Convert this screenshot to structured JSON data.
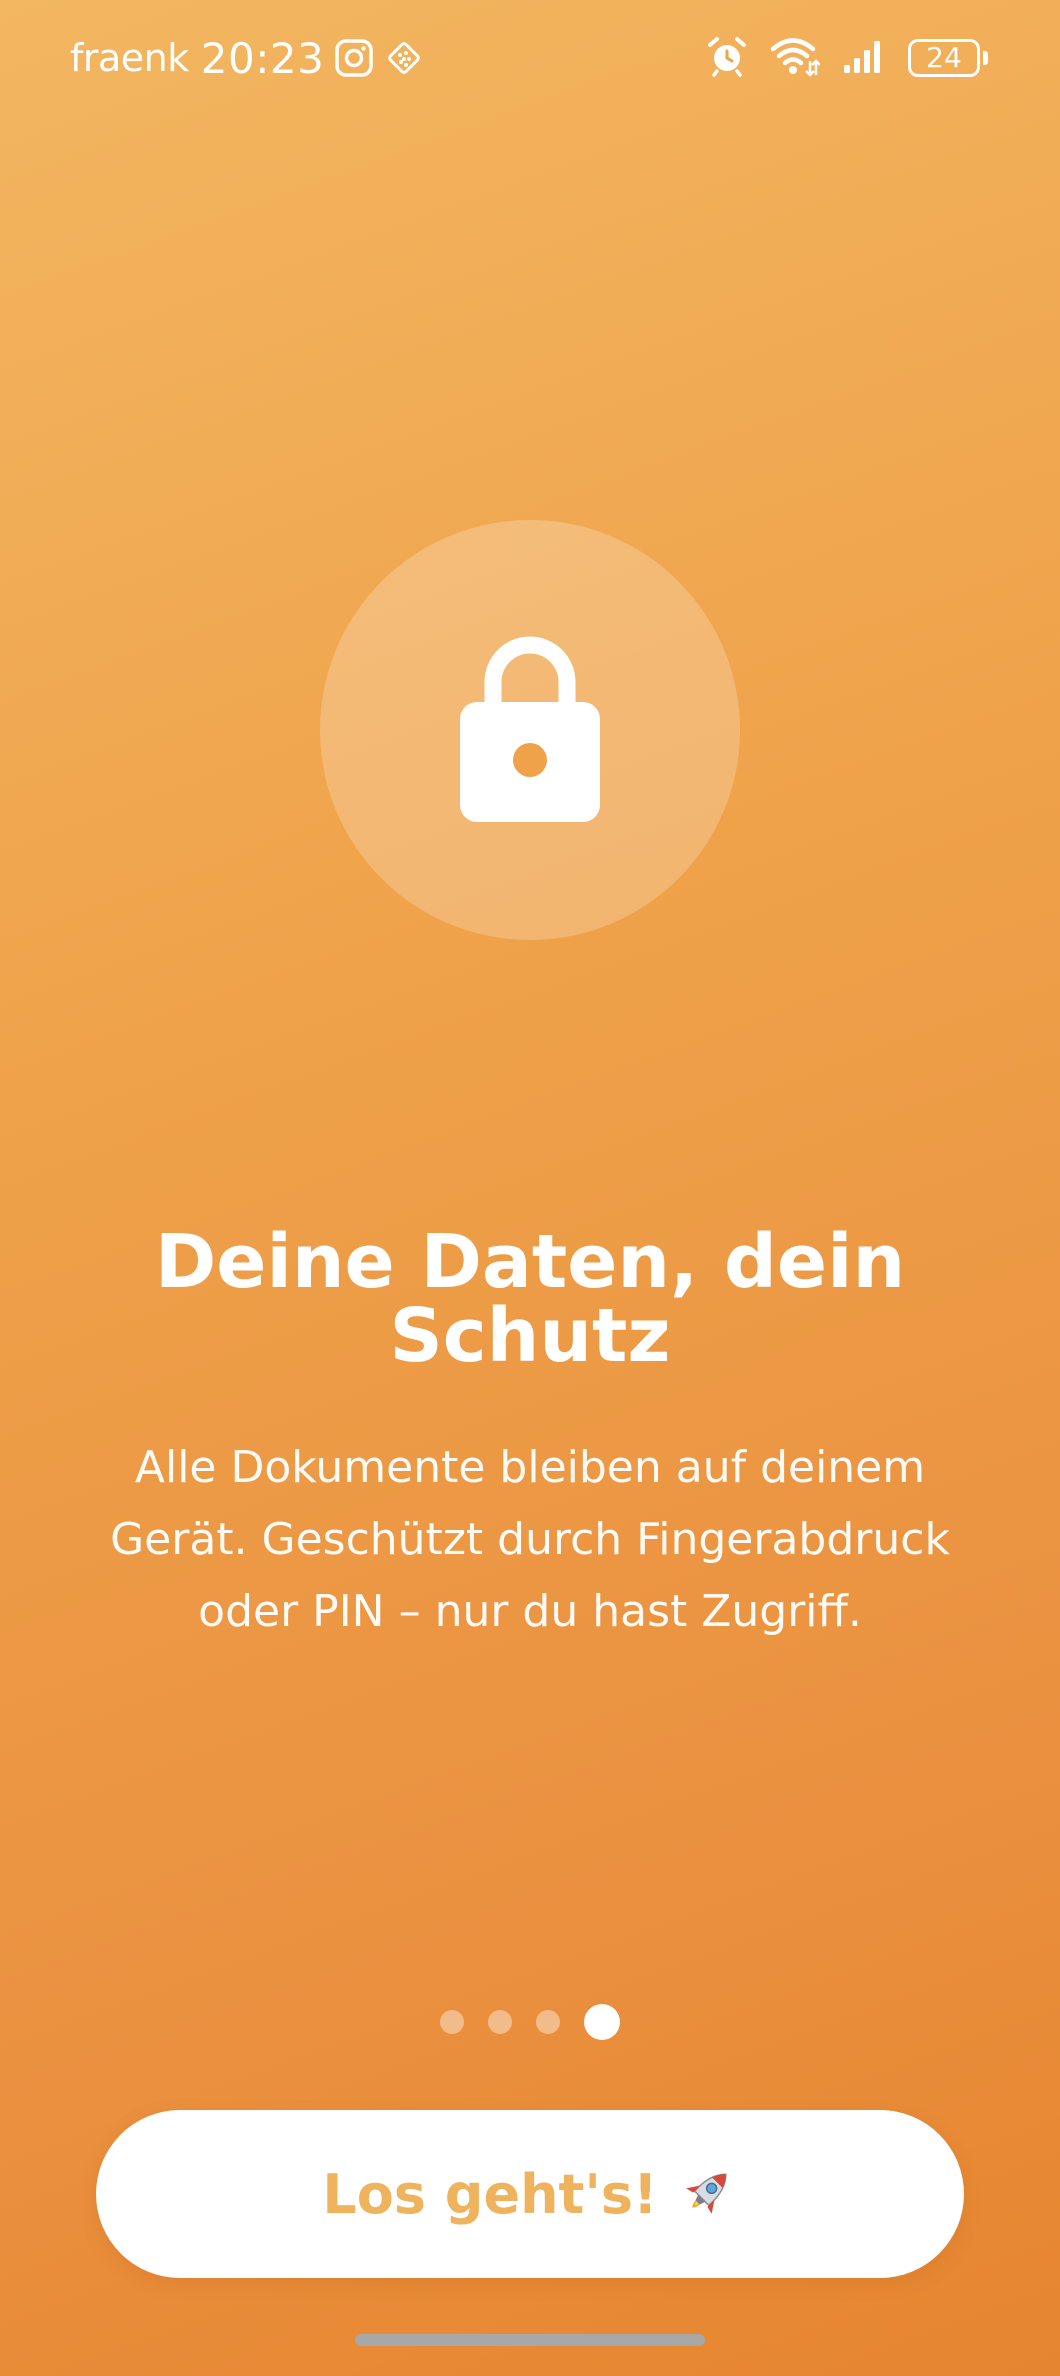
{
  "status_bar": {
    "carrier": "fraenk",
    "time": "20:23",
    "left_icons": [
      "instagram-icon",
      "app-grid-icon"
    ],
    "right_icons": [
      "alarm-icon",
      "wifi-icon",
      "signal-icon"
    ],
    "battery_level": "24"
  },
  "hero": {
    "icon": "lock-icon"
  },
  "content": {
    "title": "Deine Daten, dein Schutz",
    "description": "Alle Dokumente bleiben auf deinem Gerät. Geschützt durch Fingerabdruck oder PIN – nur du hast Zugriff."
  },
  "pager": {
    "total_pages": 4,
    "current_page": 4
  },
  "cta": {
    "label": "Los geht's!",
    "icon": "rocket-icon"
  },
  "colors": {
    "background_top": "#F3B661",
    "background_bottom": "#E6852F",
    "button_text": "#EFB35E",
    "button_background": "#FFFFFF"
  }
}
